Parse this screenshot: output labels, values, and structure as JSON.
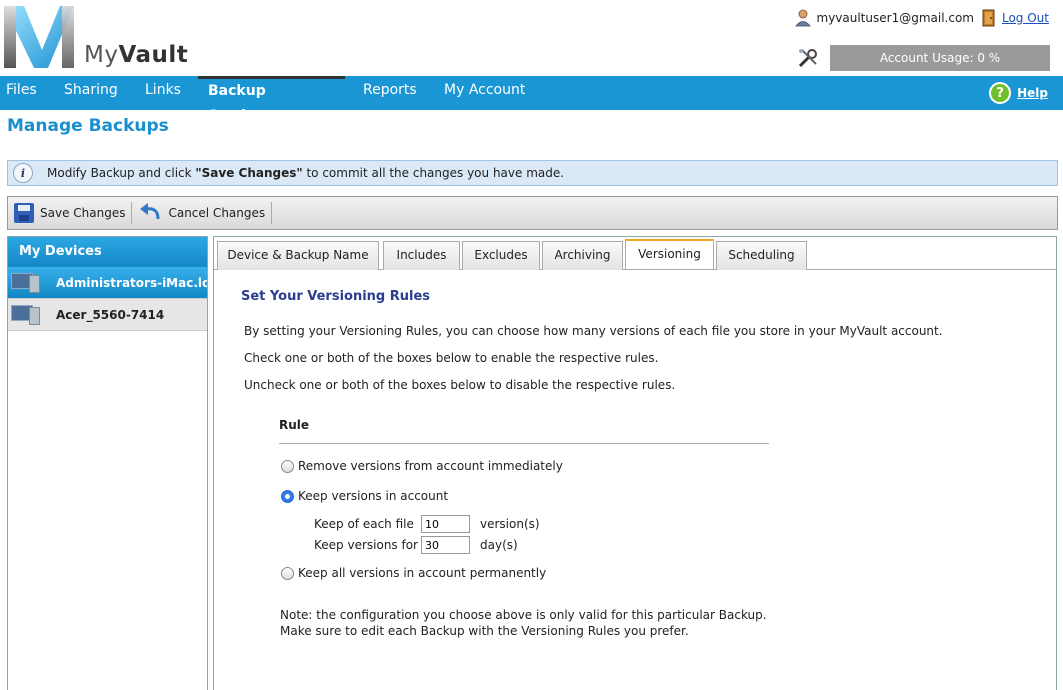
{
  "header": {
    "logo_text_light": "My",
    "logo_text_bold": "Vault",
    "user_email": "myvaultuser1@gmail.com",
    "logout_label": "Log Out",
    "account_usage": "Account Usage: 0 %"
  },
  "nav": {
    "items": [
      "Files",
      "Sharing",
      "Links",
      "Backup Settings",
      "Reports",
      "My Account"
    ],
    "active": "Backup Settings",
    "help_label": "Help"
  },
  "page_title": "Manage Backups",
  "info": {
    "text_before": "Modify Backup and click ",
    "text_bold": "\"Save Changes\"",
    "text_after": " to commit all the changes you have made."
  },
  "toolbar": {
    "save_label": "Save Changes",
    "cancel_label": "Cancel Changes"
  },
  "sidebar": {
    "title": "My Devices",
    "devices": [
      {
        "name": "Administrators-iMac.lo",
        "selected": true
      },
      {
        "name": "Acer_5560-7414",
        "selected": false
      }
    ]
  },
  "tabs": [
    "Device & Backup Name",
    "Includes",
    "Excludes",
    "Archiving",
    "Versioning",
    "Scheduling"
  ],
  "active_tab": "Versioning",
  "versioning": {
    "title": "Set Your Versioning Rules",
    "desc1": "By setting your Versioning Rules, you can choose how many versions of each file you store in your MyVault account.",
    "desc2": "Check one or both of the boxes below to enable the respective rules.",
    "desc3": "Uncheck one or both of the boxes below to disable the respective rules.",
    "rule_header": "Rule",
    "option_remove": "Remove versions from account immediately",
    "option_keep": "Keep versions in account",
    "option_keep_all": "Keep all versions in account permanently",
    "selected_option": "Keep versions in account",
    "keep_each_label": "Keep of each file",
    "keep_each_value": "10",
    "keep_each_unit": "version(s)",
    "keep_for_label": "Keep versions for",
    "keep_for_value": "30",
    "keep_for_unit": "day(s)",
    "note1": "Note: the configuration you choose above is only valid for this particular Backup.",
    "note2": "Make sure to edit each Backup with the Versioning Rules you prefer."
  }
}
